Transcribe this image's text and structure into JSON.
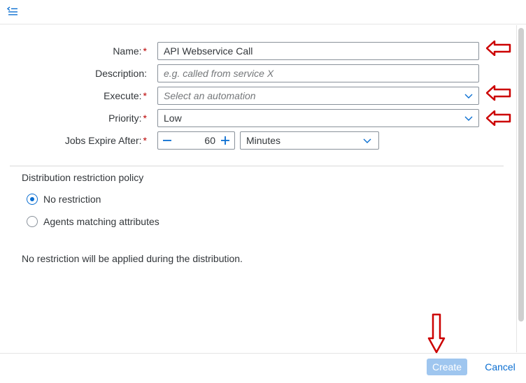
{
  "header": {
    "menu_icon": "menu-collapse-icon"
  },
  "form": {
    "name": {
      "label": "Name:",
      "required": "*",
      "value": "API Webservice Call"
    },
    "description": {
      "label": "Description:",
      "placeholder": "e.g. called from service X"
    },
    "execute": {
      "label": "Execute:",
      "required": "*",
      "placeholder": "Select an automation"
    },
    "priority": {
      "label": "Priority:",
      "required": "*",
      "value": "Low"
    },
    "jobs_expire": {
      "label": "Jobs Expire After:",
      "required": "*",
      "value": "60",
      "unit": "Minutes"
    }
  },
  "distribution": {
    "title": "Distribution restriction policy",
    "options": [
      {
        "label": "No restriction",
        "selected": true
      },
      {
        "label": "Agents matching attributes",
        "selected": false
      }
    ],
    "note": "No restriction will be applied during the distribution."
  },
  "footer": {
    "create_label": "Create",
    "cancel_label": "Cancel"
  },
  "colors": {
    "accent": "#0a6ed1",
    "required": "#bb0000",
    "annotation": "#cc0000",
    "create_disabled": "#9fc6ef"
  }
}
